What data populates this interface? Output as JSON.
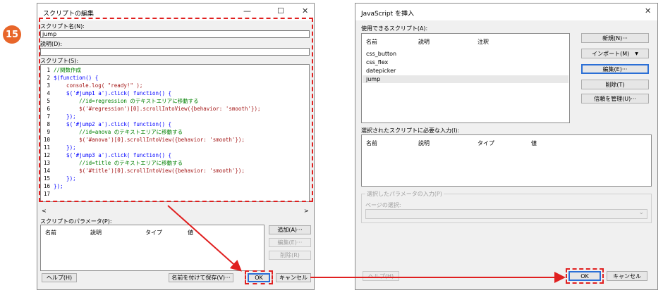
{
  "step_number": "15",
  "left_dialog": {
    "title": "スクリプトの編集",
    "minimize": "—",
    "maximize": "☐",
    "close": "✕",
    "script_name_label": "スクリプト名(N):",
    "script_name_value": "jump",
    "description_label": "説明(D):",
    "description_value": "",
    "script_label": "スクリプト(S):",
    "line_numbers": [
      "1",
      "2",
      "3",
      "4",
      "5",
      "6",
      "7",
      "8",
      "9",
      "10",
      "11",
      "12",
      "13",
      "14",
      "15",
      "16",
      "17"
    ],
    "code_lines": [
      {
        "t": "//関数作成",
        "c": "c"
      },
      {
        "t": "$(function() {",
        "c": "k"
      },
      {
        "t": "    console.log( \"ready!\" );",
        "c": "s"
      },
      {
        "t": "    $('#jump1 a').click( function() {",
        "c": "k"
      },
      {
        "t": "        //id=regression のテキストエリアに移動する",
        "c": "c"
      },
      {
        "t": "        $('#regression')[0].scrollIntoView({behavior: 'smooth'});",
        "c": "s"
      },
      {
        "t": "    });",
        "c": "k"
      },
      {
        "t": "    $('#jump2 a').click( function() {",
        "c": "k"
      },
      {
        "t": "        //id=anova のテキストエリアに移動する",
        "c": "c"
      },
      {
        "t": "        $('#anova')[0].scrollIntoView({behavior: 'smooth'});",
        "c": "s"
      },
      {
        "t": "    });",
        "c": "k"
      },
      {
        "t": "    $('#jump3 a').click( function() {",
        "c": "k"
      },
      {
        "t": "        //id=title のテキストエリアに移動する",
        "c": "c"
      },
      {
        "t": "        $('#title')[0].scrollIntoView({behavior: 'smooth'});",
        "c": "s"
      },
      {
        "t": "    });",
        "c": "k"
      },
      {
        "t": "});",
        "c": "k"
      },
      {
        "t": "",
        "c": ""
      }
    ],
    "scroll_left": "<",
    "scroll_right": ">",
    "params_label": "スクリプトのパラメータ(P):",
    "params_columns": [
      "名前",
      "説明",
      "タイプ",
      "値"
    ],
    "add_button": "追加(A)···",
    "edit_button": "編集(E)···",
    "delete_button": "削除(R)",
    "help_button": "ヘルプ(H)",
    "save_as_button": "名前を付けて保存(V)···",
    "ok_button": "OK",
    "cancel_button": "キャンセル"
  },
  "right_dialog": {
    "title": "JavaScript を挿入",
    "close": "✕",
    "available_label": "使用できるスクリプト(A):",
    "available_columns": [
      "名前",
      "説明",
      "注釈"
    ],
    "scripts": [
      "css_button",
      "css_flex",
      "datepicker",
      "jump"
    ],
    "selected_script": "jump",
    "new_button": "新規(N)···",
    "import_button": "インポート(M)",
    "import_arrow": "▼",
    "edit_button": "編集(E)···",
    "delete_button": "削除(T)",
    "trust_button": "信頼を管理(U)···",
    "inputs_label": "選択されたスクリプトに必要な入力(I):",
    "inputs_columns": [
      "名前",
      "説明",
      "タイプ",
      "値"
    ],
    "param_group_label": "選択したパラメータの入力(P)",
    "page_select_label": "ページの選択:",
    "dropdown_arrow": "⌄",
    "help_button": "ヘルプ(H)",
    "ok_button": "OK",
    "cancel_button": "キャンセル"
  },
  "colors": {
    "annotation_red": "#e02020",
    "step_circle": "#e8662a",
    "selection": "#e8e8e8",
    "focus_blue": "#2b6fd6"
  }
}
